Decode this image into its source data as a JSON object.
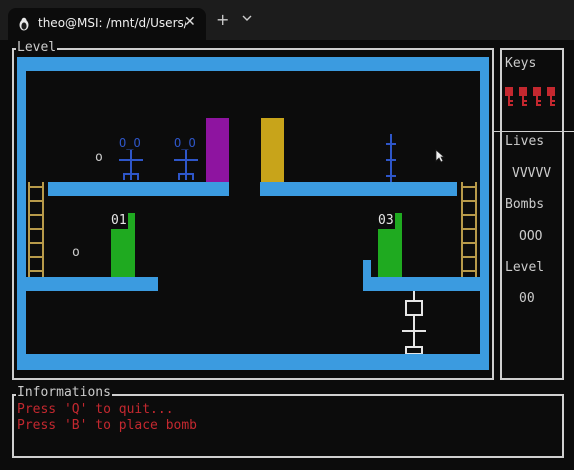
{
  "tab": {
    "icon": "linux-penguin-icon",
    "title": "theo@MSI: /mnt/d/Users/theo",
    "close": "✕",
    "new": "+",
    "dropdown": "⌄"
  },
  "level_panel": {
    "title": "Level",
    "door_labels": [
      "01",
      "03"
    ],
    "coins": [
      "o",
      "o"
    ],
    "colors": {
      "wall": "#3b9be0",
      "enemy": "#2e56c9",
      "purple_block": "#8e14a0",
      "gold_block": "#c8a41a",
      "door": "#1faa20",
      "ladder": "#b89a4a"
    }
  },
  "sidebar": {
    "keys_label": "Keys",
    "key_count": 4,
    "lives_label": "Lives",
    "lives_value": "VVVVV",
    "bombs_label": "Bombs",
    "bombs_value": "OOO",
    "level_label": "Level",
    "level_value": "00"
  },
  "info_panel": {
    "title": "Informations",
    "lines": [
      "Press 'Q' to quit...",
      "Press 'B' to place bomb"
    ]
  }
}
